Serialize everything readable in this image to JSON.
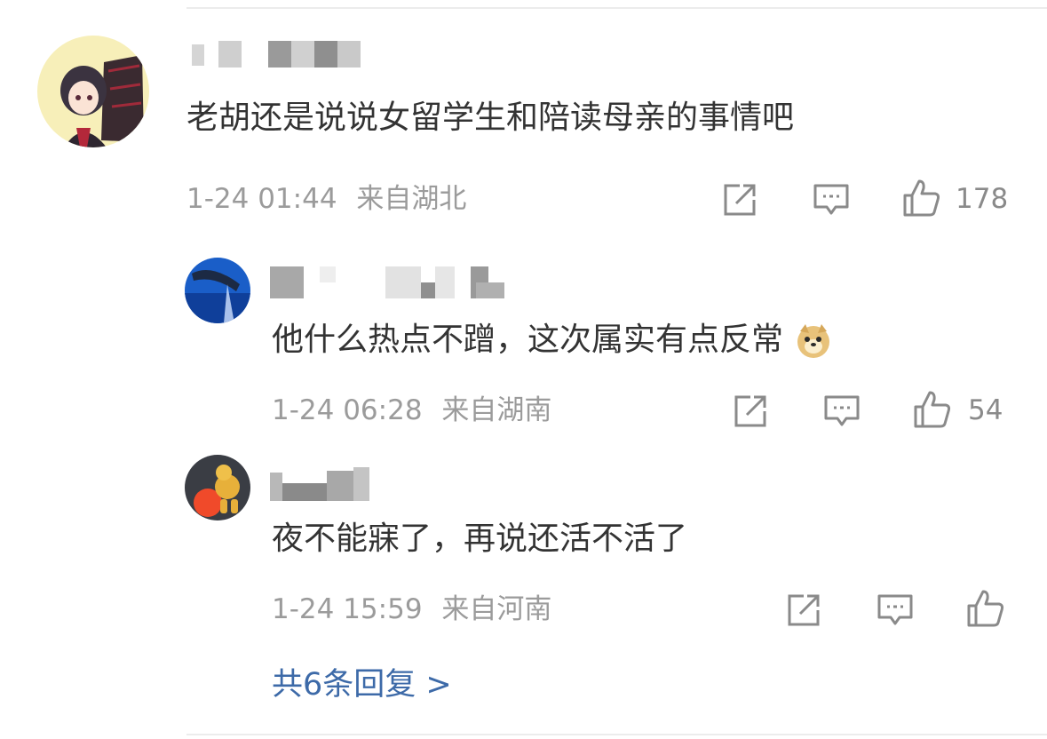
{
  "comment": {
    "text": "老胡还是说说女留学生和陪读母亲的事情吧",
    "time": "1-24 01:44",
    "location": "来自湖北",
    "likes": "178",
    "replies": [
      {
        "text": "他什么热点不蹭，这次属实有点反常",
        "emoji": "doge-emoji",
        "time": "1-24 06:28",
        "location": "来自湖南",
        "likes": "54"
      },
      {
        "text": "夜不能寐了，再说还活不活了",
        "time": "1-24 15:59",
        "location": "来自河南",
        "likes": ""
      }
    ],
    "more_replies": "共6条回复 >"
  },
  "icons": {
    "share": "share-icon",
    "reply": "comment-icon",
    "like": "thumbs-up-icon"
  },
  "colors": {
    "text": "#333333",
    "meta": "#9b9b9b",
    "link": "#3d6aa8"
  }
}
